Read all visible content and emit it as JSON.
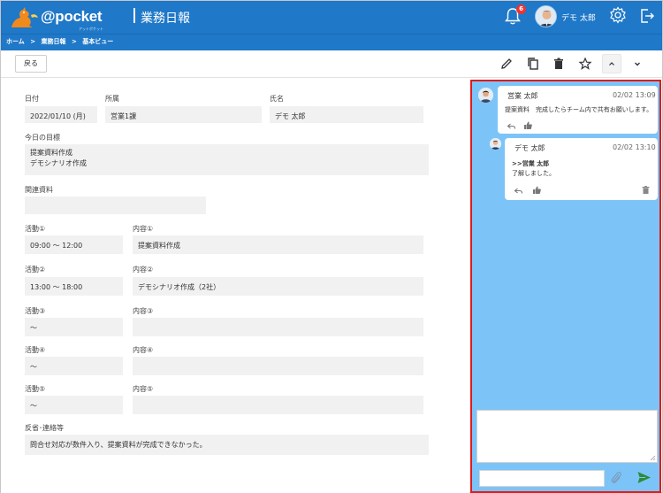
{
  "header": {
    "logo_text": "@pocket",
    "logo_subtext": "アットポケット",
    "app_title": "業務日報",
    "notification_count": "6",
    "user_name": "デモ 太郎"
  },
  "breadcrumb": [
    "ホーム",
    ">",
    "業務日報",
    ">",
    "基本ビュー"
  ],
  "toolbar": {
    "back_label": "戻る"
  },
  "form": {
    "date_label": "日付",
    "date_value": "2022/01/10 (月)",
    "dept_label": "所属",
    "dept_value": "営業1課",
    "name_label": "氏名",
    "name_value": "デモ 太郎",
    "goal_label": "今日の目標",
    "goal_lines": [
      "提案資料作成",
      "デモシナリオ作成"
    ],
    "related_label": "関連資料",
    "related_value": "",
    "activities": [
      {
        "label": "活動①",
        "time": "09:00 ～ 12:00",
        "content_label": "内容①",
        "content": "提案資料作成"
      },
      {
        "label": "活動②",
        "time": "13:00 ～ 18:00",
        "content_label": "内容②",
        "content": "デモシナリオ作成（2社）"
      },
      {
        "label": "活動③",
        "time": "～",
        "content_label": "内容③",
        "content": ""
      },
      {
        "label": "活動④",
        "time": "～",
        "content_label": "内容④",
        "content": ""
      },
      {
        "label": "活動⑤",
        "time": "～",
        "content_label": "内容⑤",
        "content": ""
      }
    ],
    "notes_label": "反省･連絡等",
    "notes_value": "問合せ対応が数件入り、提案資料が完成できなかった。"
  },
  "comments": [
    {
      "name": "営業 太郎",
      "time": "02/02 13:09",
      "text": "提案資料　完成したらチーム内で共有お願いします。"
    },
    {
      "name": "デモ 太郎",
      "time": "02/02 13:10",
      "reply_to": ">>営業 太郎",
      "text": "了解しました。"
    }
  ],
  "colors": {
    "header_bg": "#1f78c8",
    "panel_bg": "#7cc4f8",
    "highlight_border": "#e01b1b",
    "send": "#2e8b3a"
  }
}
